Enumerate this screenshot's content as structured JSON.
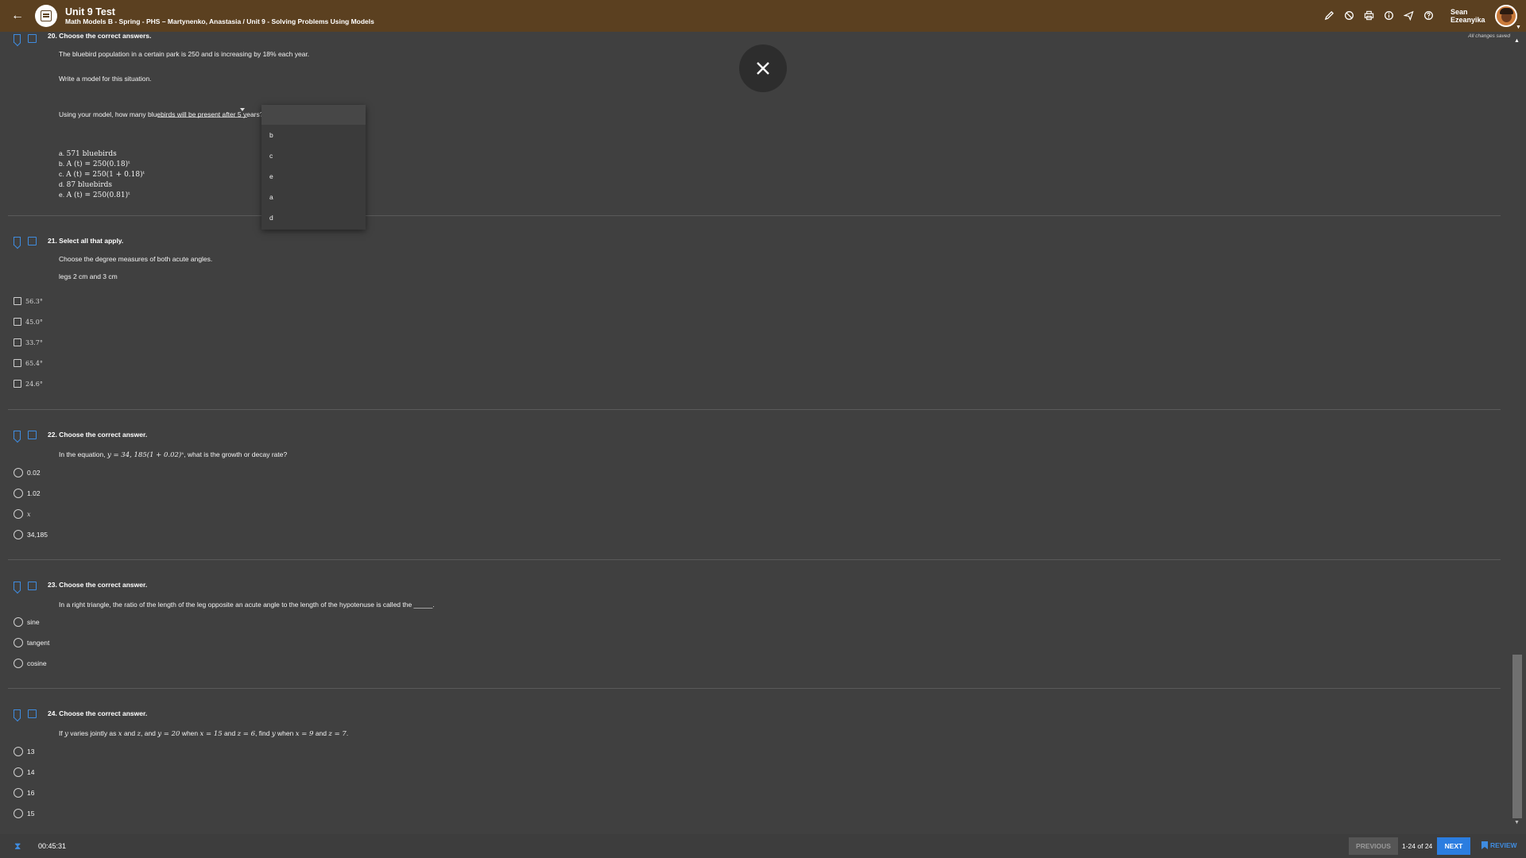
{
  "header": {
    "title": "Unit 9 Test",
    "breadcrumb": "Math Models B - Spring - PHS – Martynenko, Anastasia / Unit 9 - Solving Problems Using Models",
    "user_first": "Sean",
    "user_last": "Ezeanyika",
    "tools": [
      "pencil-icon",
      "block-icon",
      "print-icon",
      "info-icon",
      "send-icon",
      "help-icon"
    ]
  },
  "status": {
    "saved": "All changes saved"
  },
  "q20": {
    "heading": "20. Choose the correct answers.",
    "prompt": "The bluebird population in a certain park is 250 and is increasing by 18% each year.",
    "part1": "Write a model for this situation.",
    "part2": "Using your model, how many bluebirds will be present after 5 years?",
    "choices": [
      {
        "letter": "a.",
        "text": "571 bluebirds"
      },
      {
        "letter": "b.",
        "text": "A (t) = 250(0.18)ᵗ"
      },
      {
        "letter": "c.",
        "text": "A (t) = 250(1 + 0.18)ᵗ"
      },
      {
        "letter": "d.",
        "text": "87 bluebirds"
      },
      {
        "letter": "e.",
        "text": "A (t) = 250(0.81)ᵗ"
      }
    ]
  },
  "dropdown_menu": {
    "items": [
      "",
      "b",
      "c",
      "e",
      "a",
      "d"
    ]
  },
  "q21": {
    "heading": "21. Select all that apply.",
    "prompt": "Choose the degree measures of both acute angles.",
    "sub": "legs 2 cm and 3 cm",
    "options": [
      "56.3°",
      "45.0°",
      "33.7°",
      "65.4°",
      "24.6°"
    ]
  },
  "q22": {
    "heading": "22. Choose the correct answer.",
    "prompt_pre": "In the equation,",
    "prompt_math": "y = 34, 185(1 + 0.02)ˣ",
    "prompt_post": ", what is the growth or decay rate?",
    "options": [
      "0.02",
      "1.02",
      "x",
      "34,185"
    ]
  },
  "q23": {
    "heading": "23. Choose the correct answer.",
    "prompt": "In a right triangle, the ratio of the length of the leg opposite an acute angle to the length of the hypotenuse is called the _____.",
    "options": [
      "sine",
      "tangent",
      "cosine"
    ]
  },
  "q24": {
    "heading": "24. Choose the correct answer.",
    "prompt_a": "If",
    "m1": "y",
    "prompt_b": "varies jointly as",
    "m2": "x",
    "prompt_c": "and",
    "m3": "z",
    "prompt_d": ", and",
    "m4": "y = 20",
    "prompt_e": "when",
    "m5": "x = 15",
    "prompt_f": "and",
    "m6": "z = 6",
    "prompt_g": ", find",
    "m7": "y",
    "prompt_h": "when",
    "m8": "x = 9",
    "prompt_i": "and",
    "m9": "z = 7",
    "prompt_j": ".",
    "options": [
      "13",
      "14",
      "16",
      "15"
    ]
  },
  "footer": {
    "timer": "00:45:31",
    "previous": "PREVIOUS",
    "pager": "1-24 of 24",
    "next": "NEXT",
    "review": "REVIEW"
  }
}
